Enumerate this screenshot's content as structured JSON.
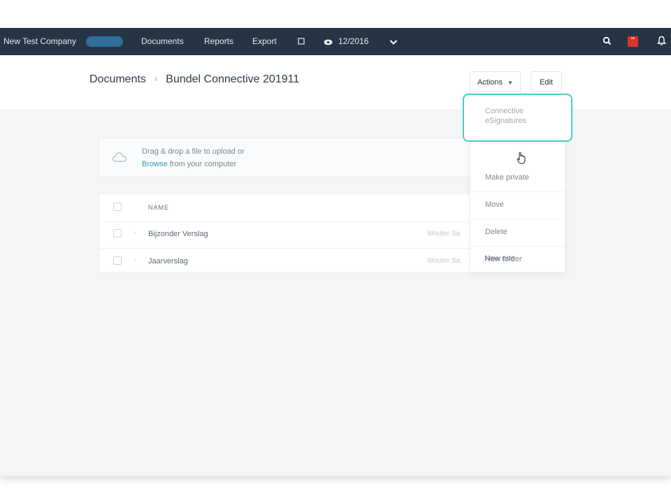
{
  "nav": {
    "company": "New Test Company",
    "badge": "",
    "documents": "Documents",
    "reports": "Reports",
    "export": "Export",
    "period": "12/2016",
    "notification_badge": "••"
  },
  "breadcrumb": {
    "root": "Documents",
    "separator": "›",
    "current": "Bundel Connective 201911"
  },
  "actions": {
    "label": "Actions",
    "edit": "Edit"
  },
  "upload": {
    "text1": "Drag & drop a file to upload or",
    "browse": "Browse",
    "text2": " from your computer"
  },
  "table": {
    "header": "NAME",
    "rows": [
      {
        "name": "Bijzonder Verslag",
        "owner": "Wouter Sa"
      },
      {
        "name": "Jaarverslag",
        "owner": "Wouter Sa"
      }
    ]
  },
  "menu": {
    "items": [
      "Connective eSignatures",
      "Make private",
      "Move",
      "Delete",
      "New folder",
      "New one"
    ]
  },
  "colors": {
    "nav_bg": "#263545",
    "accent": "#43cfc2",
    "link": "#2a9fb5",
    "alert": "#d9362b"
  }
}
